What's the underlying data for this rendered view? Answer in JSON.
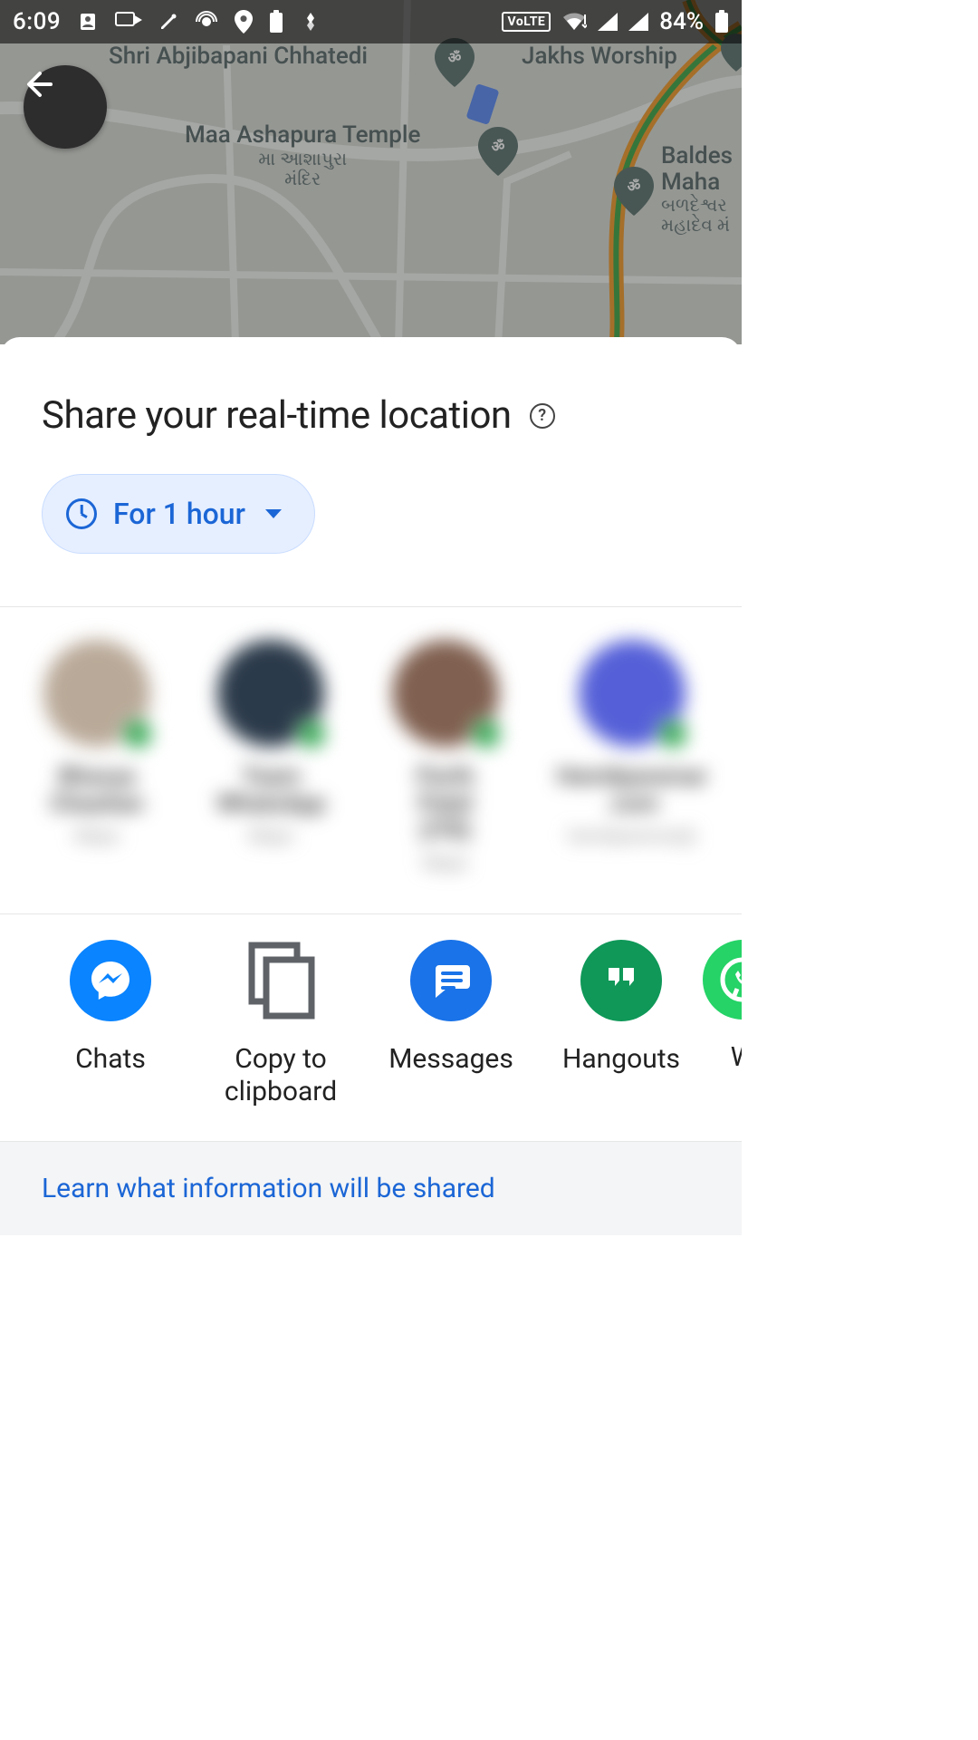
{
  "status": {
    "time": "6:09",
    "battery_pct": "84%",
    "network": "VoLTE"
  },
  "map": {
    "labels": {
      "l1": "Shri Abjibapani Chhatedi",
      "l2": "Maa Ashapura Temple",
      "l2_sub1": "મા આશાપુરા",
      "l2_sub2": "મંદિર",
      "l3": "Jakhs Worship",
      "l4_1": "Baldes",
      "l4_2": "Maha",
      "l4_sub1": "બળદેશ્વર",
      "l4_sub2": "મહાદેવ મં"
    }
  },
  "sheet": {
    "title": "Share your real-time location",
    "duration_label": "For 1 hour",
    "contacts": [
      {
        "name1": "Bhavya",
        "name2": "Chauhan",
        "sub": "Maps",
        "color": "#b9a998"
      },
      {
        "name1": "Team",
        "name2": "WhatsApp",
        "sub": "Maps",
        "color": "#2b3a4a"
      },
      {
        "name1": "Parth Patel",
        "name2": "(ITR)",
        "sub": "Maps",
        "color": "#806050"
      },
      {
        "name1": "Hemilparemar",
        "name2": ".com",
        "sub": "hemilparemar@",
        "color": "#5560d8"
      }
    ],
    "apps": [
      {
        "id": "chats",
        "label": "Chats"
      },
      {
        "id": "copy",
        "label": "Copy to\nclipboard"
      },
      {
        "id": "messages",
        "label": "Messages"
      },
      {
        "id": "hangouts",
        "label": "Hangouts"
      },
      {
        "id": "whatsapp",
        "label": "W"
      }
    ],
    "learn_link": "Learn what information will be shared"
  }
}
